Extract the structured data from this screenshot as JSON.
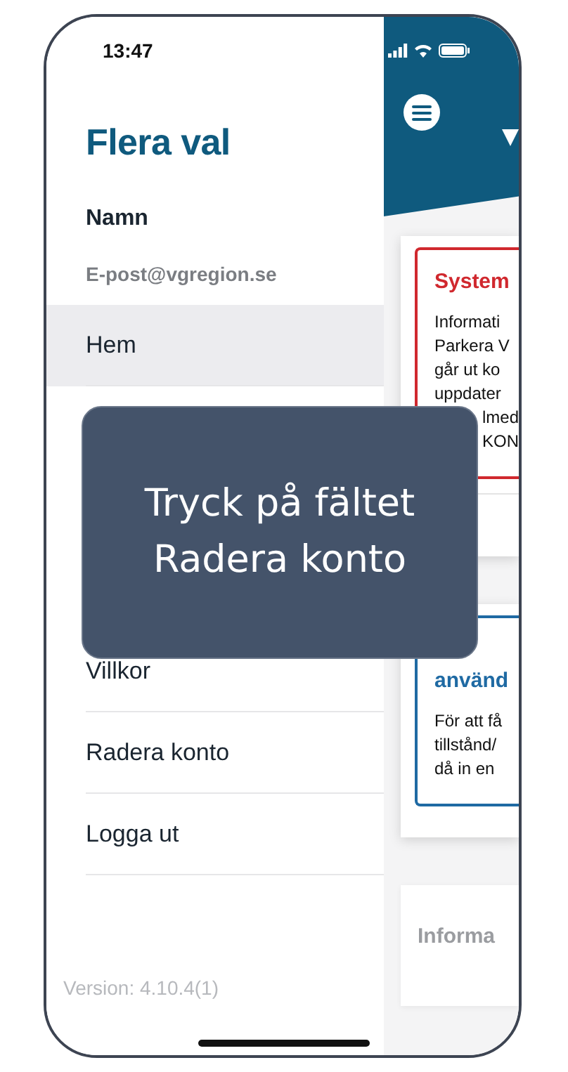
{
  "status_bar": {
    "time": "13:47"
  },
  "drawer": {
    "title": "Flera val",
    "user_name": "Namn",
    "email": "E-post@vgregion.se",
    "items": [
      {
        "label": "Hem",
        "selected": true
      },
      {
        "label": "Villkor",
        "selected": false
      },
      {
        "label": "Radera konto",
        "selected": false
      },
      {
        "label": "Logga ut",
        "selected": false
      }
    ],
    "version": "Version: 4.10.4(1)"
  },
  "main": {
    "cards": [
      {
        "kind": "alert",
        "title": "System",
        "lines": [
          {
            "text": "Informati"
          },
          {
            "text": "Parkera V"
          },
          {
            "text": "går ut ko"
          },
          {
            "text": "uppdater"
          },
          {
            "text": "lmed",
            "kind": "partial"
          },
          {
            "text": "KON",
            "kind": "partial"
          }
        ]
      },
      {
        "kind": "info",
        "title": "använd",
        "lines": [
          {
            "text": "För att få"
          },
          {
            "text": "tillstånd/"
          },
          {
            "text": "då in en"
          }
        ]
      },
      {
        "kind": "muted",
        "title": "Informa"
      }
    ]
  },
  "tooltip": {
    "text": "Tryck på fältet Radera konto"
  }
}
